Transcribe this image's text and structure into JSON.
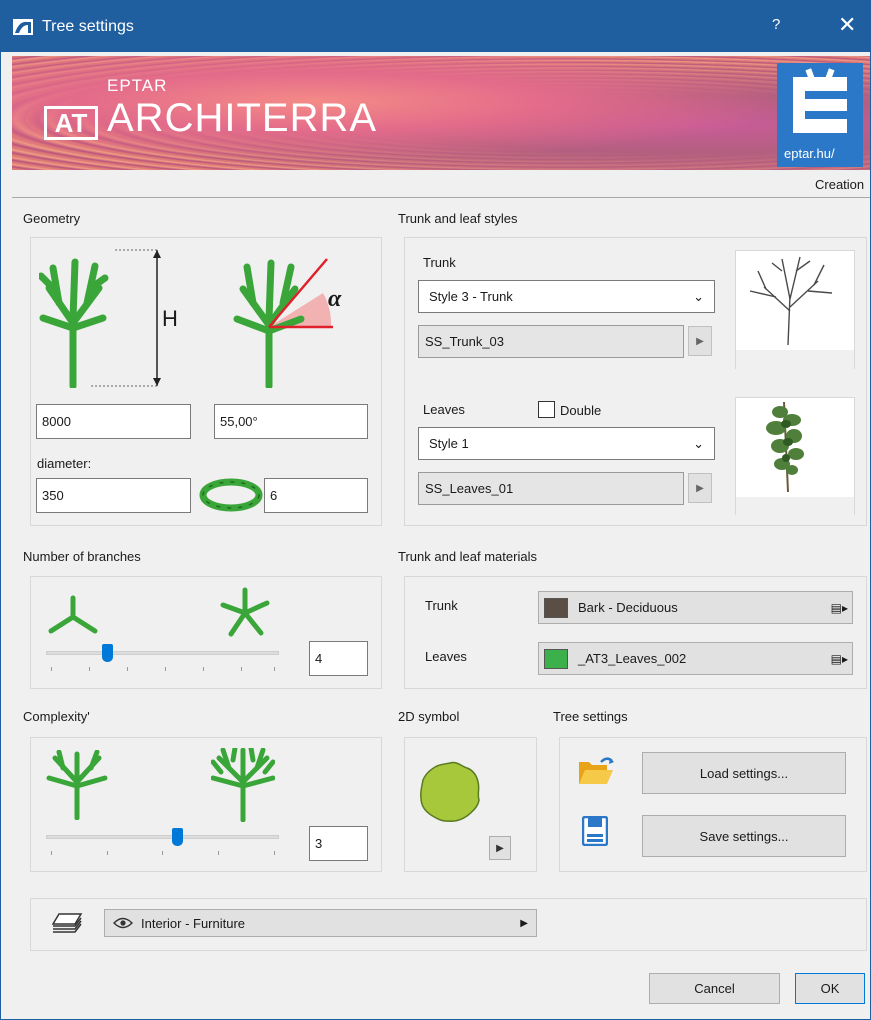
{
  "window": {
    "title": "Tree settings",
    "help_glyph": "?",
    "close_glyph": "✕"
  },
  "banner": {
    "brand_small": "EPTAR",
    "brand_large": "ARCHITERRA",
    "logo_text": "AT",
    "url": "eptar.hu/"
  },
  "creation_label": "Creation",
  "geometry": {
    "heading": "Geometry",
    "h_symbol": "H",
    "alpha_symbol": "α",
    "height_value": "8000",
    "angle_value": "55,00°",
    "diameter_label": "diameter:",
    "diameter_value": "350",
    "segments_value": "6"
  },
  "styles": {
    "heading": "Trunk and leaf styles",
    "trunk_label": "Trunk",
    "trunk_select": "Style 3 - Trunk",
    "trunk_name": "SS_Trunk_03",
    "leaves_label": "Leaves",
    "double_label": "Double",
    "double_checked": false,
    "leaves_select": "Style 1",
    "leaves_name": "SS_Leaves_01"
  },
  "branches": {
    "heading": "Number of branches",
    "value": "4",
    "slider_fraction": 0.2
  },
  "materials": {
    "heading": "Trunk and leaf materials",
    "trunk_label": "Trunk",
    "trunk_material": "Bark - Deciduous",
    "trunk_color": "#5a4e45",
    "leaves_label": "Leaves",
    "leaves_material": "_AT3_Leaves_002",
    "leaves_color": "#3cb04b"
  },
  "complexity": {
    "heading": "Complexity'",
    "value": "3",
    "slider_fraction": 0.5
  },
  "symbol2d": {
    "heading": "2D symbol",
    "fill_color": "#a8c83c"
  },
  "tree_settings": {
    "heading": "Tree settings",
    "load_label": "Load settings...",
    "save_label": "Save settings..."
  },
  "layer": {
    "value": "Interior - Furniture"
  },
  "footer": {
    "cancel_label": "Cancel",
    "ok_label": "OK"
  },
  "colors": {
    "titlebar": "#1f5e9f",
    "accent": "#0078d7",
    "tree_green": "#3aa63a"
  }
}
